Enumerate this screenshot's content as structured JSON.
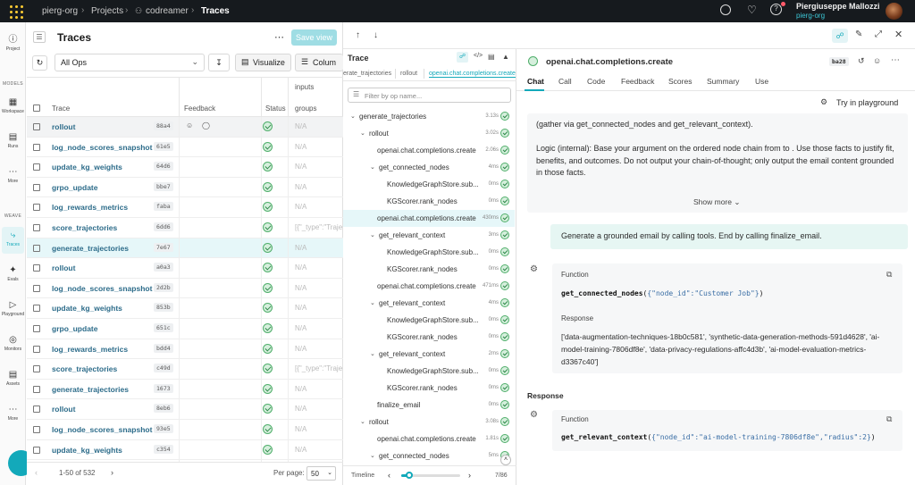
{
  "topbar": {
    "org": "pierg-org",
    "projects": "Projects",
    "project": "codreamer",
    "page": "Traces",
    "user_name": "Piergiuseppe Mallozzi",
    "user_org": "pierg-org",
    "icons": [
      "search-icon",
      "bell-icon",
      "help-icon",
      "avatar"
    ]
  },
  "leftnav": {
    "project_label": "Project",
    "models_section": "MODELS",
    "workspace_label": "Workspace",
    "runs_label": "Runs",
    "more1_label": "More",
    "weave_section": "WEAVE",
    "traces_label": "Traces",
    "evals_label": "Evals",
    "playground_label": "Playground",
    "monitors_label": "Monitors",
    "assets_label": "Assets",
    "more2_label": "More"
  },
  "traces": {
    "title": "Traces",
    "save_view": "Save view",
    "filter_value": "All Ops",
    "visualize": "Visualize",
    "columns": "Colum",
    "col_inputs": "inputs",
    "col_trace": "Trace",
    "col_feedback": "Feedback",
    "col_status": "Status",
    "col_groups": "groups",
    "rows": [
      {
        "name": "rollout",
        "id": "88a4",
        "input": "N/A"
      },
      {
        "name": "log_node_scores_snapshot",
        "id": "61e5",
        "input": "N/A"
      },
      {
        "name": "update_kg_weights",
        "id": "64d6",
        "input": "N/A"
      },
      {
        "name": "grpo_update",
        "id": "bbe7",
        "input": "N/A"
      },
      {
        "name": "log_rewards_metrics",
        "id": "faba",
        "input": "N/A"
      },
      {
        "name": "score_trajectories",
        "id": "6dd6",
        "input": "[{\"_type\":\"Traje"
      },
      {
        "name": "generate_trajectories",
        "id": "7e67",
        "input": "N/A"
      },
      {
        "name": "rollout",
        "id": "a0a3",
        "input": "N/A"
      },
      {
        "name": "log_node_scores_snapshot",
        "id": "2d2b",
        "input": "N/A"
      },
      {
        "name": "update_kg_weights",
        "id": "853b",
        "input": "N/A"
      },
      {
        "name": "grpo_update",
        "id": "651c",
        "input": "N/A"
      },
      {
        "name": "log_rewards_metrics",
        "id": "bdd4",
        "input": "N/A"
      },
      {
        "name": "score_trajectories",
        "id": "c49d",
        "input": "[{\"_type\":\"Traje"
      },
      {
        "name": "generate_trajectories",
        "id": "1673",
        "input": "N/A"
      },
      {
        "name": "rollout",
        "id": "8eb6",
        "input": "N/A"
      },
      {
        "name": "log_node_scores_snapshot",
        "id": "93e5",
        "input": "N/A"
      },
      {
        "name": "update_kg_weights",
        "id": "c354",
        "input": "N/A"
      }
    ],
    "pagination": "1-50 of 532",
    "per_page_label": "Per page:",
    "per_page_value": "50"
  },
  "tree": {
    "title": "Trace",
    "breadcrumb": [
      "erate_trajectories",
      "rollout",
      "openai.chat.completions.create"
    ],
    "filter_placeholder": "Filter by op name...",
    "rows": [
      {
        "label": "generate_trajectories",
        "dur": "3.13s",
        "chev": "v"
      },
      {
        "label": "rollout",
        "dur": "3.02s",
        "chev": "v"
      },
      {
        "label": "openai.chat.completions.create",
        "dur": "2.06s",
        "chev": ""
      },
      {
        "label": "get_connected_nodes",
        "dur": "4ms",
        "chev": "v"
      },
      {
        "label": "KnowledgeGraphStore.sub...",
        "dur": "0ms",
        "chev": ""
      },
      {
        "label": "KGScorer.rank_nodes",
        "dur": "0ms",
        "chev": ""
      },
      {
        "label": "openai.chat.completions.create",
        "dur": "430ms",
        "chev": ""
      },
      {
        "label": "get_relevant_context",
        "dur": "3ms",
        "chev": "v"
      },
      {
        "label": "KnowledgeGraphStore.sub...",
        "dur": "0ms",
        "chev": ""
      },
      {
        "label": "KGScorer.rank_nodes",
        "dur": "0ms",
        "chev": ""
      },
      {
        "label": "openai.chat.completions.create",
        "dur": "471ms",
        "chev": ""
      },
      {
        "label": "get_relevant_context",
        "dur": "4ms",
        "chev": "v"
      },
      {
        "label": "KnowledgeGraphStore.sub...",
        "dur": "0ms",
        "chev": ""
      },
      {
        "label": "KGScorer.rank_nodes",
        "dur": "0ms",
        "chev": ""
      },
      {
        "label": "get_relevant_context",
        "dur": "2ms",
        "chev": "v"
      },
      {
        "label": "KnowledgeGraphStore.sub...",
        "dur": "0ms",
        "chev": ""
      },
      {
        "label": "KGScorer.rank_nodes",
        "dur": "0ms",
        "chev": ""
      },
      {
        "label": "finalize_email",
        "dur": "0ms",
        "chev": ""
      },
      {
        "label": "rollout",
        "dur": "3.08s",
        "chev": "v"
      },
      {
        "label": "openai.chat.completions.create",
        "dur": "1.81s",
        "chev": ""
      },
      {
        "label": "get_connected_nodes",
        "dur": "5ms",
        "chev": "v"
      }
    ],
    "timeline_label": "Timeline",
    "timeline_count": "7/86"
  },
  "detail": {
    "title": "openai.chat.completions.create",
    "badge": "ba28",
    "tabs": [
      "Chat",
      "Call",
      "Code",
      "Feedback",
      "Scores",
      "Summary",
      "Use"
    ],
    "try_playground": "Try in playground",
    "sys_line1": "(gather via get_connected_nodes and get_relevant_context).",
    "sys_para": "Logic (internal): Base your argument on the ordered node chain from to . Use those facts to justify fit, benefits, and outcomes. Do not output your chain-of-thought; only output the email content grounded in those facts.",
    "show_more": "Show more",
    "user_msg": "Generate a grounded email by calling tools. End by calling finalize_email.",
    "function_label": "Function",
    "fn1_name": "get_connected_nodes",
    "fn1_args": "{\"node_id\":\"Customer Job\"}",
    "response_label": "Response",
    "response_text": "['data-augmentation-techniques-18b0c581', 'synthetic-data-generation-methods-591d4628', 'ai-model-training-7806df8e', 'data-privacy-regulations-affc4d3b', 'ai-model-evaluation-metrics-d3367c40']",
    "response_section": "Response",
    "function2_label": "Function",
    "fn2_name": "get_relevant_context",
    "fn2_args": "{\"node_id\":\"ai-model-training-7806df8e\",\"radius\":2}"
  },
  "colors": {
    "topbar": "#161a1e",
    "link": "#2d6c8a",
    "accent": "#13a9ba",
    "selected_row": "#e6f7f9"
  }
}
